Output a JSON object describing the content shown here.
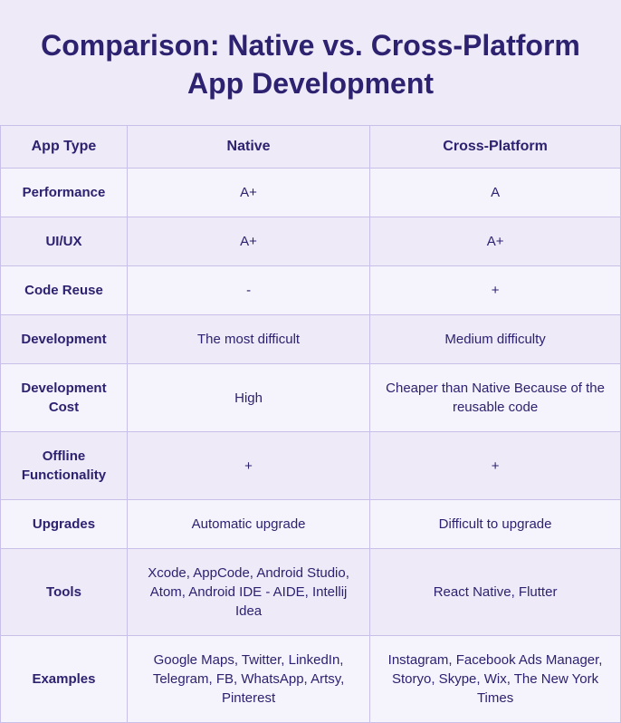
{
  "header": {
    "title": "Comparison: Native vs. Cross-Platform App Development"
  },
  "table": {
    "columns": [
      {
        "key": "feature",
        "label": "App Type"
      },
      {
        "key": "native",
        "label": "Native"
      },
      {
        "key": "crossplatform",
        "label": "Cross-Platform"
      }
    ],
    "rows": [
      {
        "feature": "Performance",
        "native": "A+",
        "crossplatform": "A"
      },
      {
        "feature": "UI/UX",
        "native": "A+",
        "crossplatform": "A+"
      },
      {
        "feature": "Code Reuse",
        "native": "-",
        "crossplatform": "+"
      },
      {
        "feature": "Development",
        "native": "The most difficult",
        "crossplatform": "Medium difficulty"
      },
      {
        "feature": "Development Cost",
        "native": "High",
        "crossplatform": "Cheaper than Native Because of the reusable code"
      },
      {
        "feature": "Offline Functionality",
        "native": "+",
        "crossplatform": "+"
      },
      {
        "feature": "Upgrades",
        "native": "Automatic upgrade",
        "crossplatform": "Difficult to upgrade"
      },
      {
        "feature": "Tools",
        "native": "Xcode, AppCode, Android Studio, Atom, Android IDE - AIDE, Intellij Idea",
        "crossplatform": "React Native, Flutter"
      },
      {
        "feature": "Examples",
        "native": "Google Maps, Twitter, LinkedIn, Telegram, FB, WhatsApp, Artsy, Pinterest",
        "crossplatform": "Instagram, Facebook Ads Manager, Storyo, Skype, Wix, The New York Times"
      }
    ]
  }
}
